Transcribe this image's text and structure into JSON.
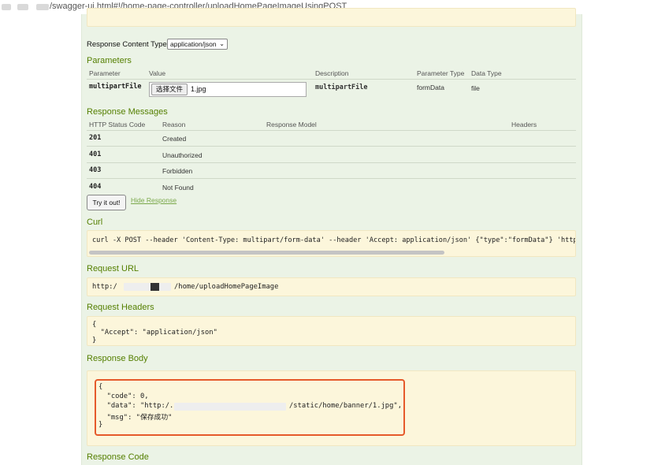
{
  "browser": {
    "url": "/swagger-ui.html#!/home-page-controller/uploadHomePageImageUsingPOST"
  },
  "response_content_type": {
    "label": "Response Content Type",
    "selected": "application/json"
  },
  "parameters": {
    "title": "Parameters",
    "headers": [
      "Parameter",
      "Value",
      "Description",
      "Parameter Type",
      "Data Type"
    ],
    "row": {
      "name": "multipartFile",
      "file_button": "选择文件",
      "file_name": "1.jpg",
      "description": "multipartFile",
      "param_type": "formData",
      "data_type": "file"
    }
  },
  "response_messages": {
    "title": "Response Messages",
    "headers": [
      "HTTP Status Code",
      "Reason",
      "Response Model",
      "Headers"
    ],
    "rows": [
      {
        "code": "201",
        "reason": "Created"
      },
      {
        "code": "401",
        "reason": "Unauthorized"
      },
      {
        "code": "403",
        "reason": "Forbidden"
      },
      {
        "code": "404",
        "reason": "Not Found"
      }
    ]
  },
  "actions": {
    "try_label": "Try it out!",
    "hide_label": "Hide Response"
  },
  "curl": {
    "title": "Curl",
    "command": "curl -X POST --header 'Content-Type: multipart/form-data' --header 'Accept: application/json' {\"type\":\"formData\"} 'http"
  },
  "request_url": {
    "title": "Request URL",
    "prefix": "http:/",
    "suffix": "/home/uploadHomePageImage"
  },
  "request_headers": {
    "title": "Request Headers",
    "lines": [
      "{",
      "  \"Accept\": \"application/json\"",
      "}"
    ]
  },
  "response_body": {
    "title": "Response Body",
    "open": "{",
    "line_code": "  \"code\": 0,",
    "line_data_prefix": "  \"data\": \"http:/.",
    "line_data_suffix": "/static/home/banner/1.jpg\",",
    "line_msg": "  \"msg\": \"保存成功\"",
    "close": "}"
  },
  "response_code": {
    "title": "Response Code"
  },
  "colors": {
    "section_title": "#547f00",
    "panel_bg": "#ebf3e6",
    "code_box_bg": "#fcf6db",
    "highlight_border": "#e55a2b"
  }
}
